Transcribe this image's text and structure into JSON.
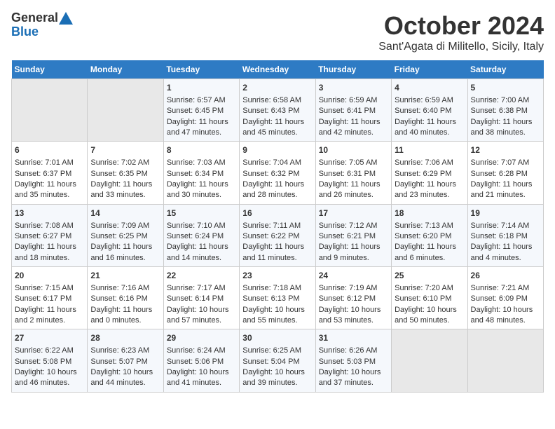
{
  "header": {
    "logo_line1": "General",
    "logo_line2": "Blue",
    "month_title": "October 2024",
    "location": "Sant'Agata di Militello, Sicily, Italy"
  },
  "days_of_week": [
    "Sunday",
    "Monday",
    "Tuesday",
    "Wednesday",
    "Thursday",
    "Friday",
    "Saturday"
  ],
  "weeks": [
    [
      {
        "day": "",
        "empty": true
      },
      {
        "day": "",
        "empty": true
      },
      {
        "day": "1",
        "sunrise": "6:57 AM",
        "sunset": "6:45 PM",
        "daylight": "11 hours and 47 minutes."
      },
      {
        "day": "2",
        "sunrise": "6:58 AM",
        "sunset": "6:43 PM",
        "daylight": "11 hours and 45 minutes."
      },
      {
        "day": "3",
        "sunrise": "6:59 AM",
        "sunset": "6:41 PM",
        "daylight": "11 hours and 42 minutes."
      },
      {
        "day": "4",
        "sunrise": "6:59 AM",
        "sunset": "6:40 PM",
        "daylight": "11 hours and 40 minutes."
      },
      {
        "day": "5",
        "sunrise": "7:00 AM",
        "sunset": "6:38 PM",
        "daylight": "11 hours and 38 minutes."
      }
    ],
    [
      {
        "day": "6",
        "sunrise": "7:01 AM",
        "sunset": "6:37 PM",
        "daylight": "11 hours and 35 minutes."
      },
      {
        "day": "7",
        "sunrise": "7:02 AM",
        "sunset": "6:35 PM",
        "daylight": "11 hours and 33 minutes."
      },
      {
        "day": "8",
        "sunrise": "7:03 AM",
        "sunset": "6:34 PM",
        "daylight": "11 hours and 30 minutes."
      },
      {
        "day": "9",
        "sunrise": "7:04 AM",
        "sunset": "6:32 PM",
        "daylight": "11 hours and 28 minutes."
      },
      {
        "day": "10",
        "sunrise": "7:05 AM",
        "sunset": "6:31 PM",
        "daylight": "11 hours and 26 minutes."
      },
      {
        "day": "11",
        "sunrise": "7:06 AM",
        "sunset": "6:29 PM",
        "daylight": "11 hours and 23 minutes."
      },
      {
        "day": "12",
        "sunrise": "7:07 AM",
        "sunset": "6:28 PM",
        "daylight": "11 hours and 21 minutes."
      }
    ],
    [
      {
        "day": "13",
        "sunrise": "7:08 AM",
        "sunset": "6:27 PM",
        "daylight": "11 hours and 18 minutes."
      },
      {
        "day": "14",
        "sunrise": "7:09 AM",
        "sunset": "6:25 PM",
        "daylight": "11 hours and 16 minutes."
      },
      {
        "day": "15",
        "sunrise": "7:10 AM",
        "sunset": "6:24 PM",
        "daylight": "11 hours and 14 minutes."
      },
      {
        "day": "16",
        "sunrise": "7:11 AM",
        "sunset": "6:22 PM",
        "daylight": "11 hours and 11 minutes."
      },
      {
        "day": "17",
        "sunrise": "7:12 AM",
        "sunset": "6:21 PM",
        "daylight": "11 hours and 9 minutes."
      },
      {
        "day": "18",
        "sunrise": "7:13 AM",
        "sunset": "6:20 PM",
        "daylight": "11 hours and 6 minutes."
      },
      {
        "day": "19",
        "sunrise": "7:14 AM",
        "sunset": "6:18 PM",
        "daylight": "11 hours and 4 minutes."
      }
    ],
    [
      {
        "day": "20",
        "sunrise": "7:15 AM",
        "sunset": "6:17 PM",
        "daylight": "11 hours and 2 minutes."
      },
      {
        "day": "21",
        "sunrise": "7:16 AM",
        "sunset": "6:16 PM",
        "daylight": "11 hours and 0 minutes."
      },
      {
        "day": "22",
        "sunrise": "7:17 AM",
        "sunset": "6:14 PM",
        "daylight": "10 hours and 57 minutes."
      },
      {
        "day": "23",
        "sunrise": "7:18 AM",
        "sunset": "6:13 PM",
        "daylight": "10 hours and 55 minutes."
      },
      {
        "day": "24",
        "sunrise": "7:19 AM",
        "sunset": "6:12 PM",
        "daylight": "10 hours and 53 minutes."
      },
      {
        "day": "25",
        "sunrise": "7:20 AM",
        "sunset": "6:10 PM",
        "daylight": "10 hours and 50 minutes."
      },
      {
        "day": "26",
        "sunrise": "7:21 AM",
        "sunset": "6:09 PM",
        "daylight": "10 hours and 48 minutes."
      }
    ],
    [
      {
        "day": "27",
        "sunrise": "6:22 AM",
        "sunset": "5:08 PM",
        "daylight": "10 hours and 46 minutes."
      },
      {
        "day": "28",
        "sunrise": "6:23 AM",
        "sunset": "5:07 PM",
        "daylight": "10 hours and 44 minutes."
      },
      {
        "day": "29",
        "sunrise": "6:24 AM",
        "sunset": "5:06 PM",
        "daylight": "10 hours and 41 minutes."
      },
      {
        "day": "30",
        "sunrise": "6:25 AM",
        "sunset": "5:04 PM",
        "daylight": "10 hours and 39 minutes."
      },
      {
        "day": "31",
        "sunrise": "6:26 AM",
        "sunset": "5:03 PM",
        "daylight": "10 hours and 37 minutes."
      },
      {
        "day": "",
        "empty": true
      },
      {
        "day": "",
        "empty": true
      }
    ]
  ]
}
